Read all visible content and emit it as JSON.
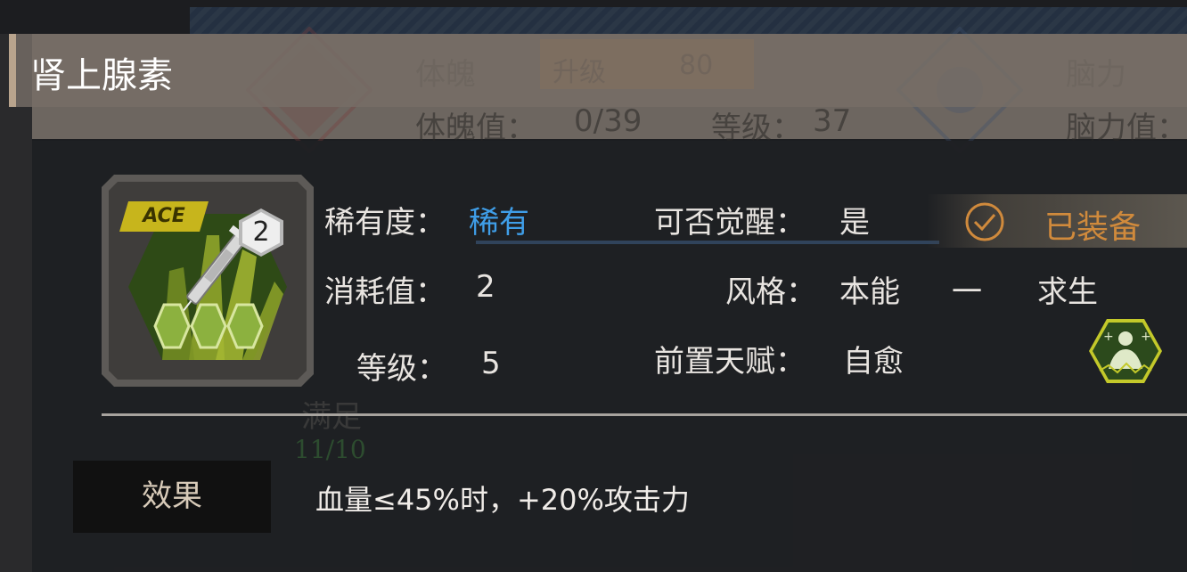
{
  "background": {
    "stat_left_name": "体魄",
    "stat_left_value_label": "体魄值：",
    "stat_left_value": "0/39",
    "upgrade_label": "升级",
    "upgrade_cost": "80",
    "level_label": "等级：",
    "level_value": "37",
    "stat_right_name": "脑力",
    "stat_right_value_label": "脑力值：",
    "satisfied_label": "满足",
    "satisfied_value": "11/10"
  },
  "item": {
    "name": "肾上腺素",
    "tier_badge": "ACE",
    "item_level": "2",
    "rarity_label": "稀有度：",
    "rarity_value": "稀有",
    "rarity_color": "#3f9ee8",
    "cost_label": "消耗值：",
    "cost_value": "2",
    "level_label": "等级：",
    "level_value": "5",
    "awaken_label": "可否觉醒：",
    "awaken_value": "是",
    "style_label": "风格：",
    "style_value_1": "本能",
    "style_separator": "一",
    "style_value_2": "求生",
    "prereq_label": "前置天赋：",
    "prereq_value": "自愈",
    "prereq_icon": "self-heal-talent-icon",
    "equipped_status": "已装备",
    "equipped_icon": "check-circle-icon",
    "effect_tab_label": "效果",
    "effect_text": "血量≤45%时，+20%攻击力"
  }
}
